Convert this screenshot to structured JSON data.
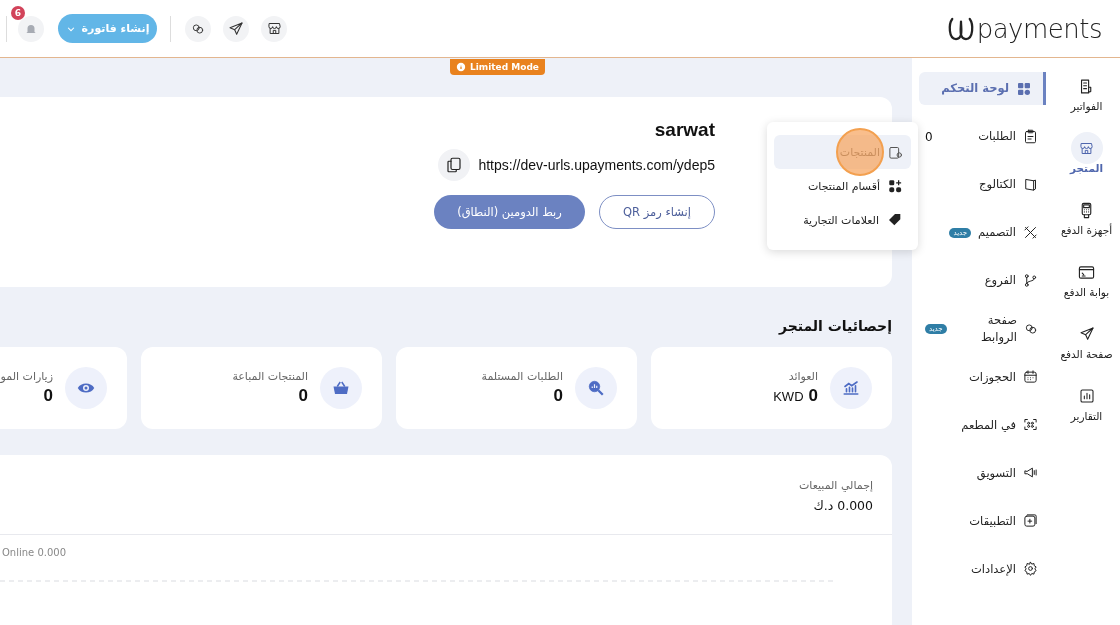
{
  "header": {
    "notification_count": "6",
    "create_invoice": "إنشاء فاتورة",
    "logo": "payments"
  },
  "limited_mode": "Limited Mode",
  "store": {
    "name": "sarwat",
    "url": "https://dev-urls.upayments.com/ydep5",
    "buttons": [
      {
        "label": "إنشاء رمز QR",
        "kind": "outline"
      },
      {
        "label": "ربط الدومين (النطاق)",
        "kind": "filled"
      }
    ]
  },
  "stats": {
    "title": "إحصائيات المتجر",
    "cards": [
      {
        "label": "العوائد",
        "value": "0",
        "unit": "KWD"
      },
      {
        "label": "الطلبات المستلمة",
        "value": "0"
      },
      {
        "label": "المنتجات المباعة",
        "value": "0"
      },
      {
        "label": "زيارات المو",
        "value": "0"
      }
    ]
  },
  "sales": {
    "title": "إجمالي المبيعات",
    "total": "0.000 د.ك",
    "legend": "Online 0.000"
  },
  "nav": {
    "items": [
      {
        "label": "لوحة التحكم",
        "selected": true
      },
      {
        "label": "الطلبات",
        "selected": false,
        "count": "0"
      },
      {
        "label": "الكتالوج",
        "selected": false
      },
      {
        "label": "التصميم",
        "selected": false,
        "badge": "جديد"
      },
      {
        "label": "الفروع",
        "selected": false
      },
      {
        "label": "صفحة الروابط",
        "selected": false,
        "badge": "جديد"
      },
      {
        "label": "الحجوزات",
        "selected": false
      },
      {
        "label": "في المطعم",
        "selected": false
      },
      {
        "label": "التسويق",
        "selected": false
      },
      {
        "label": "التطبيقات",
        "selected": false
      },
      {
        "label": "الإعدادات",
        "selected": false
      }
    ]
  },
  "rail": {
    "items": [
      {
        "label": "الفواتير",
        "selected": false
      },
      {
        "label": "المتجر",
        "selected": true
      },
      {
        "label": "أجهزة الدفع",
        "selected": false
      },
      {
        "label": "بوابة الدفع",
        "selected": false
      },
      {
        "label": "صفحة الدفع",
        "selected": false
      },
      {
        "label": "التقارير",
        "selected": false
      }
    ]
  },
  "flyout": {
    "items": [
      {
        "label": "المنتجات",
        "selected": true
      },
      {
        "label": "أقسام المنتجات",
        "selected": false
      },
      {
        "label": "العلامات التجارية",
        "selected": false
      }
    ]
  }
}
